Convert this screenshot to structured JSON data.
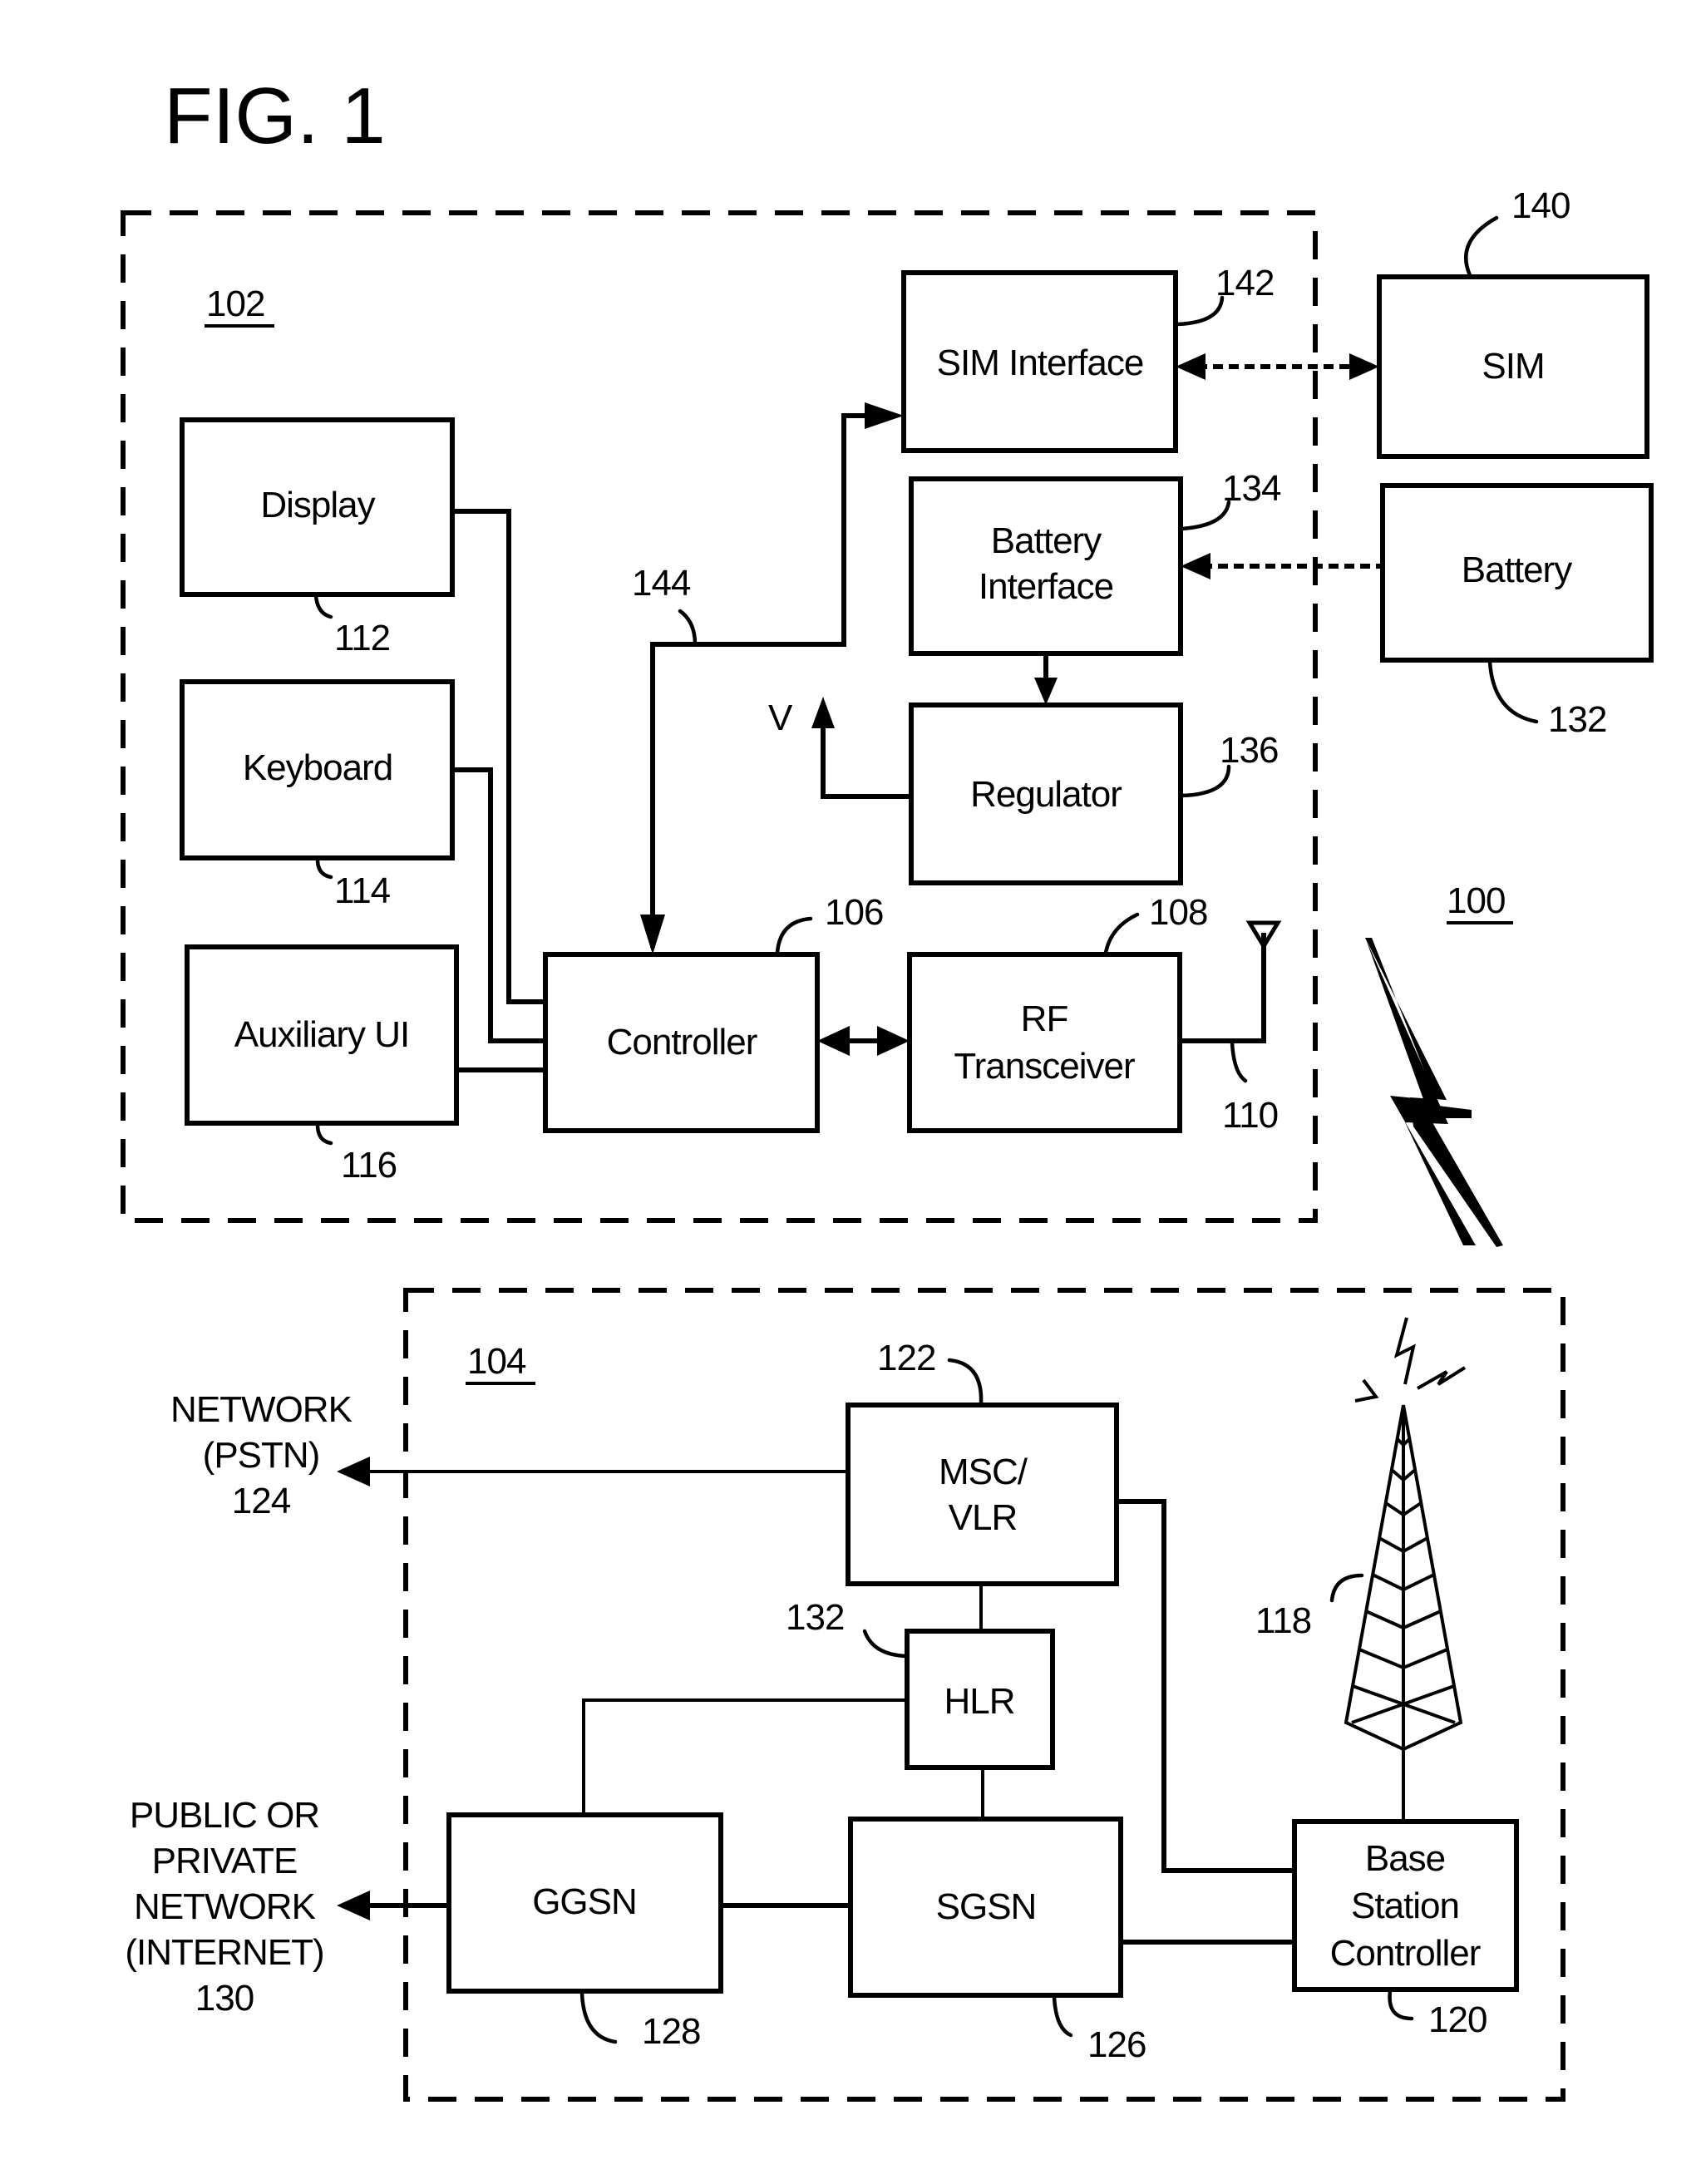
{
  "figure": {
    "title": "FIG. 1",
    "system_ref": "100"
  },
  "mobile_device": {
    "ref": "102",
    "blocks": {
      "display": {
        "label": "Display",
        "ref": "112"
      },
      "keyboard": {
        "label": "Keyboard",
        "ref": "114"
      },
      "auxiliary_ui": {
        "label": "Auxiliary UI",
        "ref": "116"
      },
      "controller": {
        "label": "Controller",
        "ref": "106"
      },
      "rf_transceiver": {
        "label_line1": "RF",
        "label_line2": "Transceiver",
        "ref": "108"
      },
      "antenna": {
        "ref": "110"
      },
      "regulator": {
        "label": "Regulator",
        "ref": "136",
        "output_label": "V"
      },
      "battery_interface": {
        "label_line1": "Battery",
        "label_line2": "Interface",
        "ref": "134"
      },
      "sim_interface": {
        "label": "SIM Interface",
        "ref": "142"
      },
      "bus": {
        "ref": "144"
      }
    }
  },
  "external_components": {
    "sim": {
      "label": "SIM",
      "ref": "140"
    },
    "battery": {
      "label": "Battery",
      "ref": "132"
    }
  },
  "network": {
    "ref": "104",
    "blocks": {
      "msc_vlr": {
        "label_line1": "MSC/",
        "label_line2": "VLR",
        "ref": "122"
      },
      "hlr": {
        "label": "HLR",
        "ref": "132"
      },
      "ggsn": {
        "label": "GGSN",
        "ref": "128"
      },
      "sgsn": {
        "label": "SGSN",
        "ref": "126"
      },
      "bsc": {
        "label_line1": "Base",
        "label_line2": "Station",
        "label_line3": "Controller",
        "ref": "120"
      },
      "tower": {
        "ref": "118"
      }
    },
    "pstn": {
      "line1": "NETWORK",
      "line2": "(PSTN)",
      "ref": "124"
    },
    "internet": {
      "line1": "PUBLIC OR",
      "line2": "PRIVATE",
      "line3": "NETWORK",
      "line4": "(INTERNET)",
      "ref": "130"
    }
  }
}
